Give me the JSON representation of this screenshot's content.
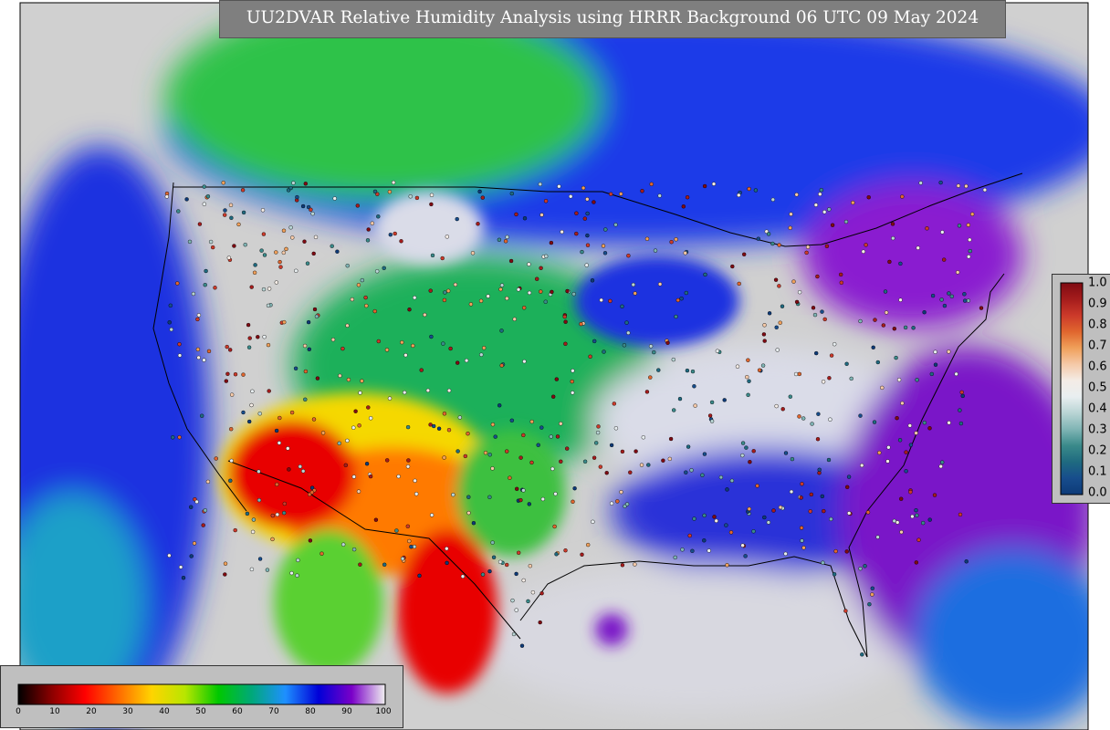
{
  "title": "UU2DVAR Relative Humidity Analysis using HRRR Background 06 UTC 09 May 2024",
  "colors": {
    "panel_gray": "#bfbfbf",
    "title_bg": "#7f7f7f",
    "land_mask": "#d0d0d0",
    "border": "#000000"
  },
  "rh_colorbar": {
    "ticks": [
      "0",
      "10",
      "20",
      "30",
      "40",
      "50",
      "60",
      "70",
      "80",
      "90",
      "100"
    ],
    "stops": [
      "#000000",
      "#8b0000",
      "#ff0000",
      "#ff6a00",
      "#ffd400",
      "#b8e600",
      "#00c800",
      "#00a87a",
      "#1e90ff",
      "#0000d8",
      "#7a00c8",
      "#f0f0f0"
    ]
  },
  "obs_colorbar": {
    "ticks": [
      "1.0",
      "0.9",
      "0.8",
      "0.7",
      "0.6",
      "0.5",
      "0.4",
      "0.3",
      "0.2",
      "0.1",
      "0.0"
    ],
    "stops": [
      "#7f0a12",
      "#a51c1c",
      "#cc3a2a",
      "#e0662e",
      "#f0a05a",
      "#f5c9a8",
      "#f4ece6",
      "#e8eef0",
      "#b8d4d4",
      "#7fb4b4",
      "#3a8a8a",
      "#1f6a80",
      "#174d8c",
      "#0d3a78"
    ]
  },
  "map_icon": "contiguous-us-relative-humidity-field"
}
